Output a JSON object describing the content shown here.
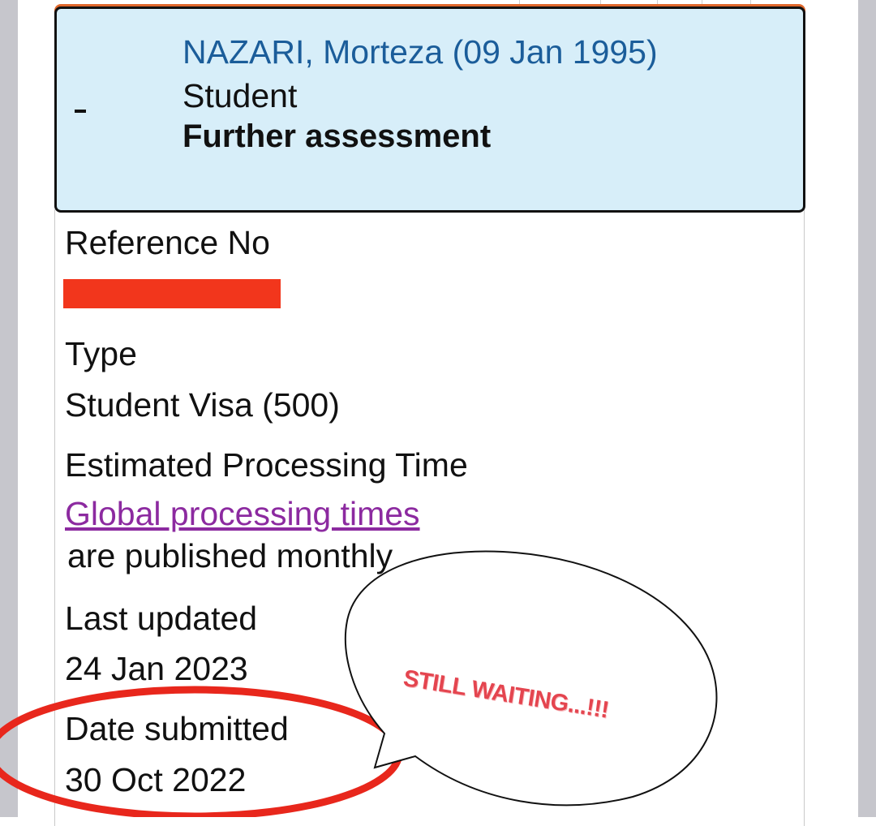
{
  "header": {
    "toggle_symbol": "-",
    "applicant_name": "NAZARI, Morteza (09 Jan 1995)",
    "stream": "Student",
    "status": "Further assessment"
  },
  "fields": {
    "reference_label": "Reference No",
    "type_label": "Type",
    "type_value": "Student Visa (500)",
    "processing_label": "Estimated Processing Time",
    "processing_link": "Global processing times",
    "processing_note": "are published monthly",
    "updated_label": "Last updated",
    "updated_value": "24 Jan 2023",
    "submitted_label": "Date submitted",
    "submitted_value": "30 Oct 2022"
  },
  "annotation": {
    "bubble_text": "STILL WAITING...!!!",
    "circle_color": "#e8271c",
    "bubble_text_color": "#e4454f",
    "redaction_color": "#f2361c"
  },
  "colors": {
    "header_bg": "#d7eef9",
    "name_color": "#1b5d9a",
    "link_color": "#8c2aa0",
    "accent_top": "#e0672b"
  }
}
